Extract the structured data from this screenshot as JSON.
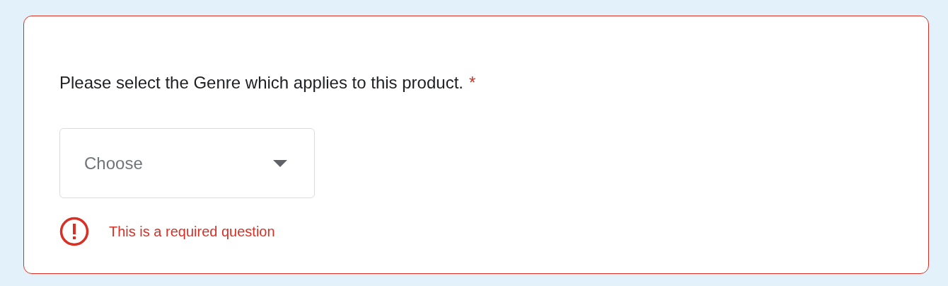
{
  "question": {
    "text": "Please select the Genre which applies to this product.",
    "required_mark": "*",
    "invalid": true
  },
  "dropdown": {
    "placeholder": "Choose"
  },
  "error": {
    "message": "This is a required question"
  }
}
